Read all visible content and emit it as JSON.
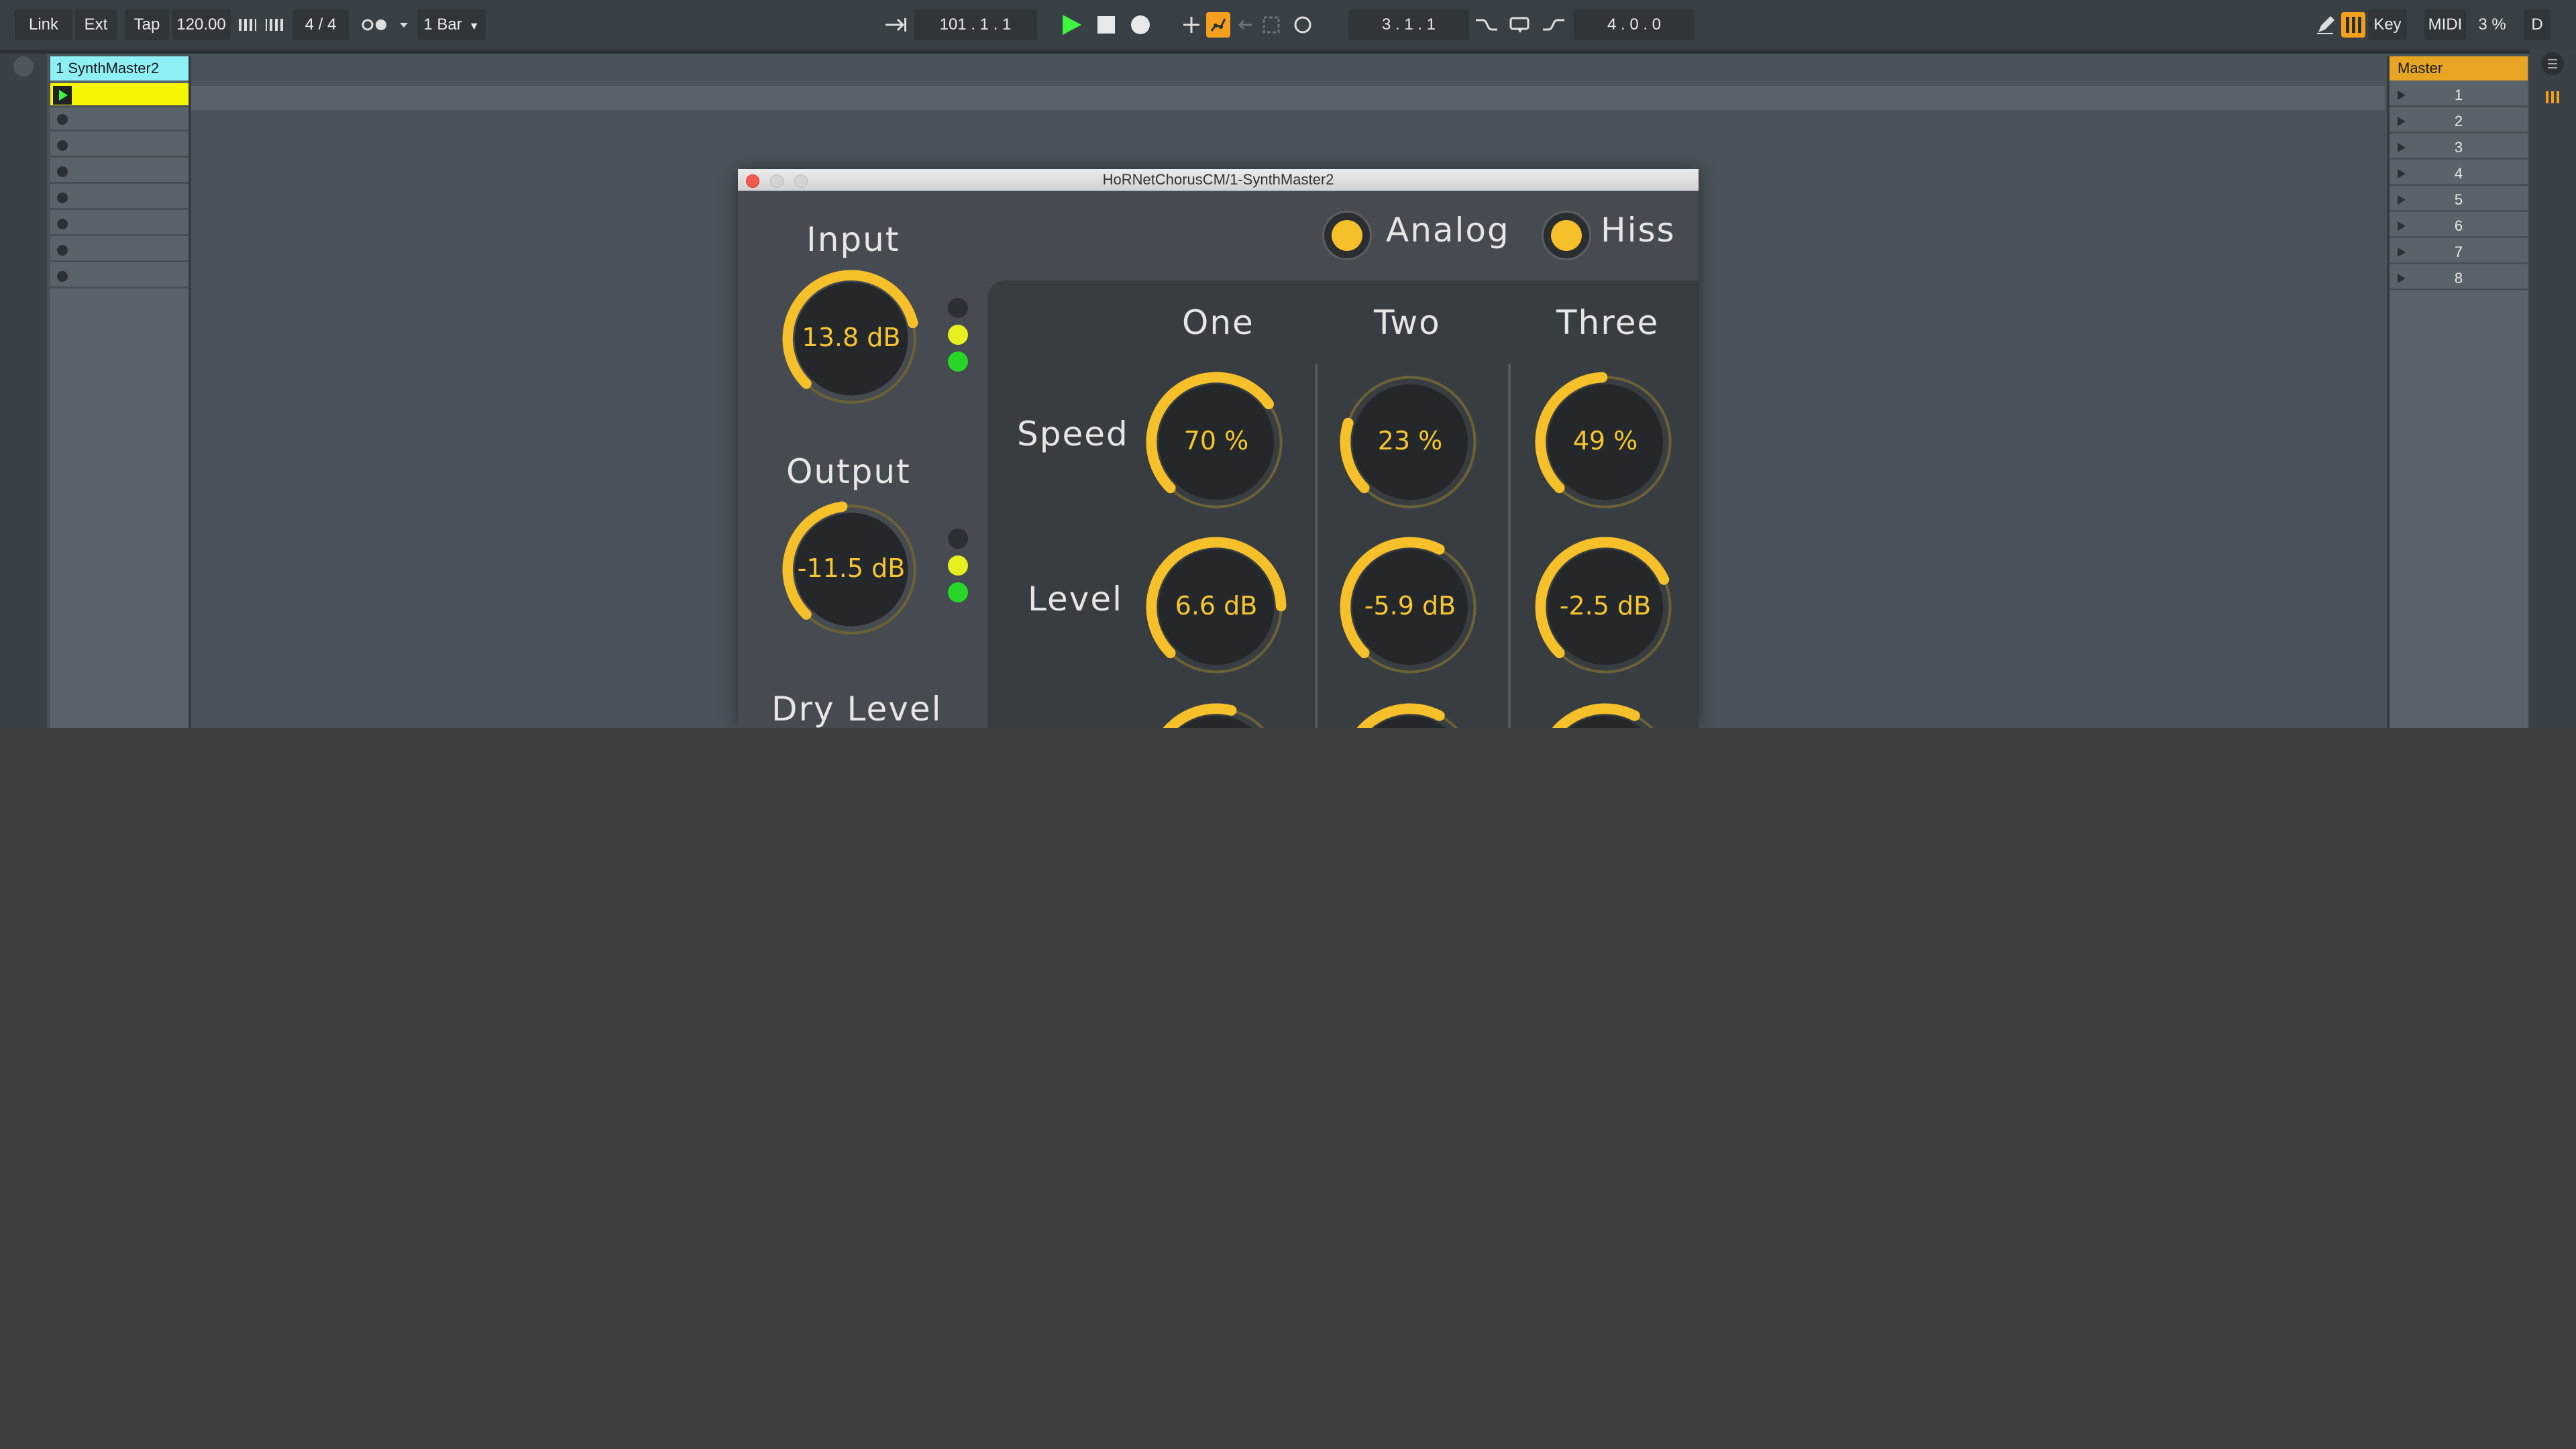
{
  "transport": {
    "link": "Link",
    "ext": "Ext",
    "tap": "Tap",
    "tempo": "120.00",
    "signature": "4 / 4",
    "quantization": "1 Bar",
    "arrangement_position": "101 .  1 .  1",
    "loop_start": "3 .  1 .  1",
    "loop_length": "4 .  0 .  0",
    "key": "Key",
    "midi": "MIDI",
    "cpu": "3 %",
    "d": "D"
  },
  "tracks": {
    "track1": {
      "name": "1 SynthMaster2",
      "slot_count": 8,
      "active_slot": 1
    }
  },
  "master": {
    "name": "Master",
    "scenes": [
      "1",
      "2",
      "3",
      "4",
      "5",
      "6",
      "7",
      "8"
    ]
  },
  "plugin": {
    "title": "HoRNetChorusCM/1-SynthMaster2",
    "toggles": {
      "analog": "Analog",
      "hiss": "Hiss"
    },
    "labels": {
      "input": "Input",
      "output": "Output",
      "dry_level": "Dry Level",
      "speed": "Speed",
      "level": "Level"
    },
    "columns": [
      "One",
      "Two",
      "Three"
    ],
    "knobs": {
      "input": {
        "value": "13.8 dB",
        "position": 0.78
      },
      "output": {
        "value": "-11.5 dB",
        "position": 0.47
      },
      "speed": [
        {
          "value": "70 %",
          "position": 0.7
        },
        {
          "value": "23 %",
          "position": 0.23
        },
        {
          "value": "49 %",
          "position": 0.49
        }
      ],
      "level": [
        {
          "value": "6.6 dB",
          "position": 0.83
        },
        {
          "value": "-5.9 dB",
          "position": 0.6
        },
        {
          "value": "-2.5 dB",
          "position": 0.74
        }
      ]
    }
  },
  "colors": {
    "accent_yellow": "#f5c02a",
    "track_clip": "#f5f500",
    "track_header": "#8ef0f5",
    "master_header": "#e8a523",
    "play_green": "#3ef53e",
    "led_green": "#28d628",
    "led_yellow": "#e8ef1e"
  }
}
